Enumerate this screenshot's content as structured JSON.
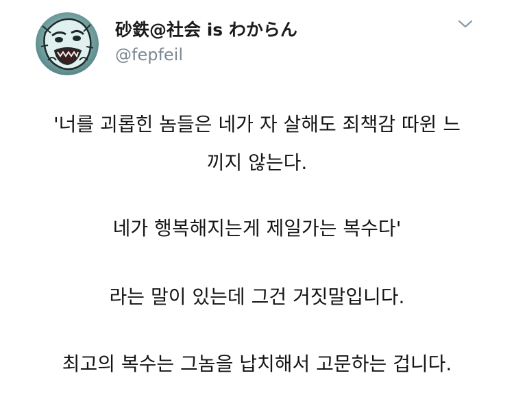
{
  "tweet": {
    "author": {
      "display_name": "砂鉄@社会 is わからん",
      "handle": "@fepfeil"
    },
    "menu_icon": "chevron-down-icon",
    "avatar_icon": "avatar",
    "body_lines": [
      "'너를 괴롭힌 놈들은 네가 자 살해도 죄책감 따윈 느",
      "끼지 않는다.",
      "네가 행복해지는게 제일가는 복수다'",
      "라는 말이 있는데 그건 거짓말입니다.",
      "최고의 복수는 그놈을 납치해서 고문하는 겁니다."
    ]
  },
  "colors": {
    "background": "#ffffff",
    "name_text": "#1a1a1a",
    "handle_text": "#7b8892",
    "body_text": "#141414",
    "chevron": "#8899a6"
  }
}
